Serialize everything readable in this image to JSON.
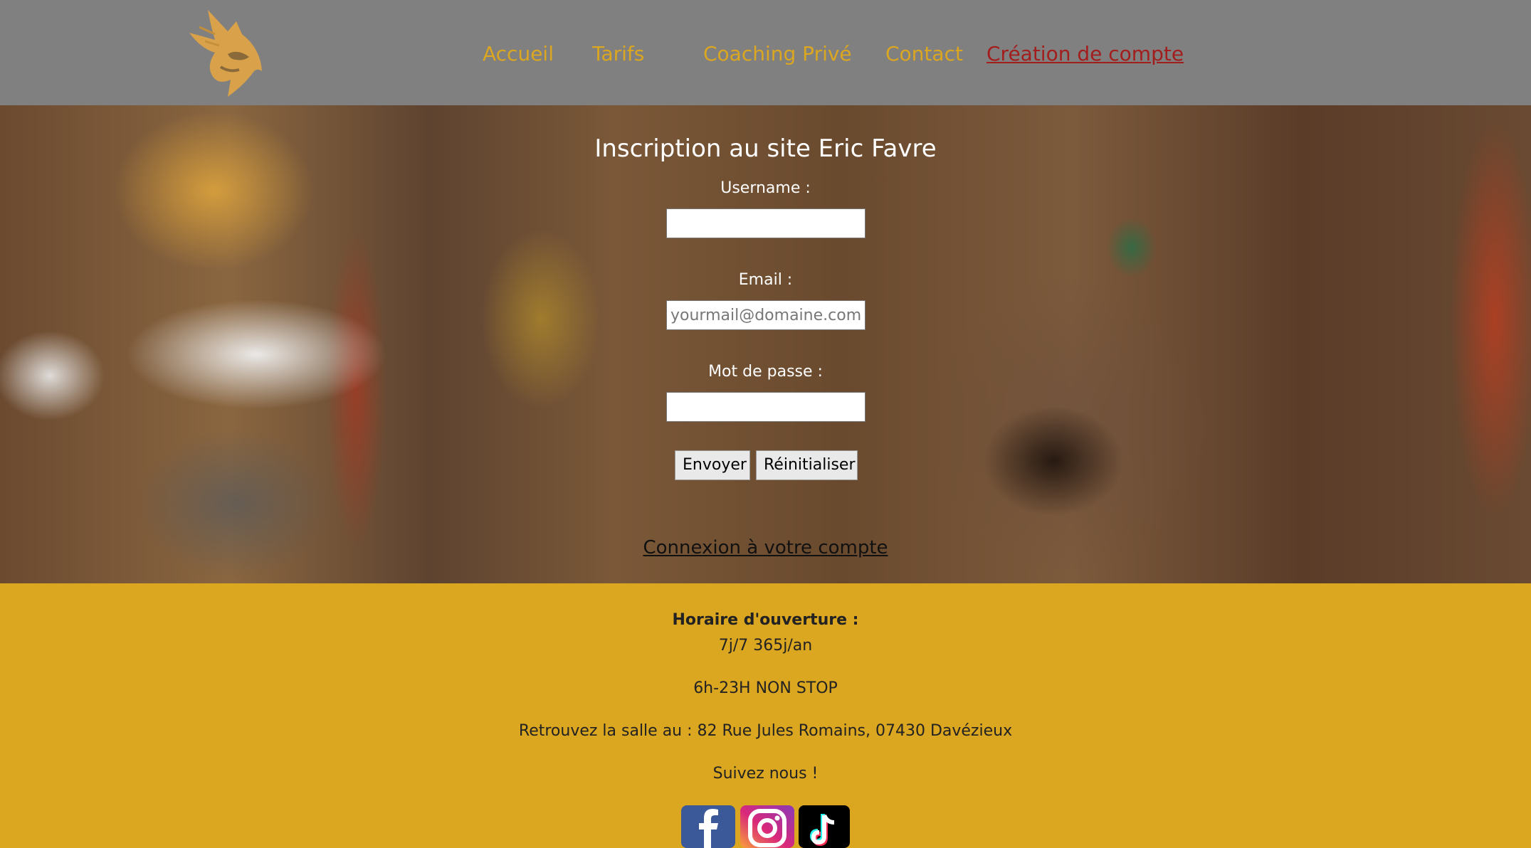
{
  "nav": {
    "items": [
      {
        "label": "Accueil"
      },
      {
        "label": "Tarifs"
      },
      {
        "label": "Coaching Privé"
      },
      {
        "label": "Contact"
      },
      {
        "label": "Création de compte"
      }
    ]
  },
  "form": {
    "title": "Inscription au site Eric Favre",
    "username_label": "Username :",
    "username_value": "",
    "email_label": "Email :",
    "email_placeholder": "yourmail@domaine.com",
    "password_label": "Mot de passe :",
    "password_value": "",
    "submit_label": "Envoyer",
    "reset_label": "Réinitialiser",
    "login_link": "Connexion à votre compte"
  },
  "footer": {
    "hours_title": "Horaire d'ouverture :",
    "days": "7j/7 365j/an",
    "hours": "6h-23H NON STOP",
    "address": "Retrouvez la salle au : 82 Rue Jules Romains, 07430 Davézieux",
    "follow": "Suivez nous !"
  },
  "colors": {
    "header_bg": "#808080",
    "nav_text": "#dba620",
    "nav_active": "#a31d1d",
    "footer_bg": "#dba620"
  },
  "icons": [
    "lynx-logo-icon",
    "facebook-icon",
    "instagram-icon",
    "tiktok-icon"
  ]
}
